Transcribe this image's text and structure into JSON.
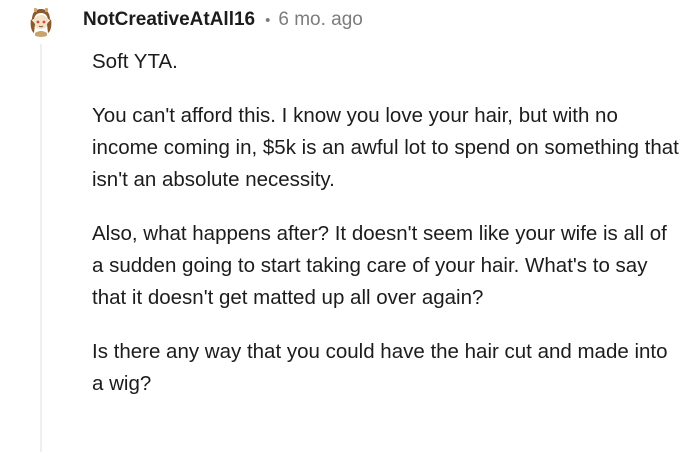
{
  "comment": {
    "username": "NotCreativeAtAll16",
    "separator": "•",
    "timestamp": "6 mo. ago",
    "avatar_icon": "snoo-avatar-icon",
    "paragraphs": [
      "Soft YTA.",
      "You can't afford this. I know you love your hair, but with no income coming in, $5k is an awful lot to spend on something that isn't an absolute necessity.",
      "Also, what happens after? It doesn't seem like your wife is all of a sudden going to start taking care of your hair. What's to say that it doesn't get matted up all over again?",
      "Is there any way that you could have the hair cut and made into a wig?"
    ]
  },
  "colors": {
    "text": "#1c1c1c",
    "meta": "#7c7c7c",
    "thread_line": "#edeff1"
  }
}
